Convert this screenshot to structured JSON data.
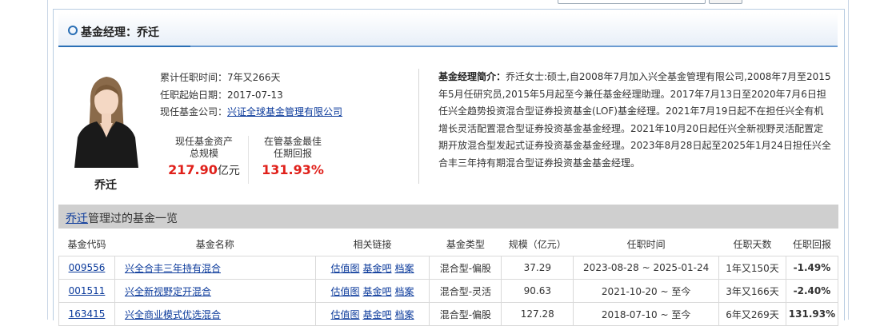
{
  "panel": {
    "title": "基金经理：乔迁"
  },
  "manager": {
    "name": "乔迁",
    "tenure_label": "累计任职时间：",
    "tenure_value": "7年又266天",
    "start_label": "任职起始日期：",
    "start_value": "2017-07-13",
    "company_label": "现任基金公司：",
    "company_value": "兴证全球基金管理有限公司"
  },
  "stats": {
    "assets_label_line1": "现任基金资产",
    "assets_label_line2": "总规模",
    "assets_value": "217.90",
    "assets_unit": "亿元",
    "best_label_line1": "在管基金最佳",
    "best_label_line2": "任期回报",
    "best_value": "131.93%"
  },
  "bio": {
    "label": "基金经理简介：",
    "text": "乔迁女士:硕士,自2008年7月加入兴全基金管理有限公司,2008年7月至2015年5月任研究员,2015年5月起至今兼任基金经理助理。2017年7月13日至2020年7月6日担任兴全趋势投资混合型证券投资基金(LOF)基金经理。2021年7月19日起不在担任兴全有机增长灵活配置混合型证券投资基金基金经理。2021年10月20日起任兴全新视野灵活配置定期开放混合型发起式证券投资基金基金经理。2023年8月28日起至2025年1月24日担任兴全合丰三年持有期混合型证券投资基金基金经理。"
  },
  "fund_list": {
    "manager_link": "乔迁",
    "title_suffix": "管理过的基金一览",
    "columns": [
      "基金代码",
      "基金名称",
      "相关链接",
      "基金类型",
      "规模（亿元）",
      "任职时间",
      "任职天数",
      "任职回报"
    ],
    "link_labels": [
      "估值图",
      "基金吧",
      "档案"
    ],
    "rows": [
      {
        "code": "009556",
        "name": "兴全合丰三年持有混合",
        "type": "混合型-偏股",
        "size": "37.29",
        "period": "2023-08-28 ~ 2025-01-24",
        "days": "1年又150天",
        "return": "-1.49%",
        "positive": false
      },
      {
        "code": "001511",
        "name": "兴全新视野定开混合",
        "type": "混合型-灵活",
        "size": "90.63",
        "period": "2021-10-20 ~ 至今",
        "days": "3年又166天",
        "return": "-2.40%",
        "positive": false
      },
      {
        "code": "163415",
        "name": "兴全商业模式优选混合",
        "type": "混合型-偏股",
        "size": "127.28",
        "period": "2018-07-10 ~ 至今",
        "days": "6年又269天",
        "return": "131.93%",
        "positive": true
      }
    ]
  },
  "colors": {
    "accent": "#2a6fb5",
    "positive": "#e0201a",
    "negative": "#1f9a1f",
    "link": "#0b3a9b"
  }
}
